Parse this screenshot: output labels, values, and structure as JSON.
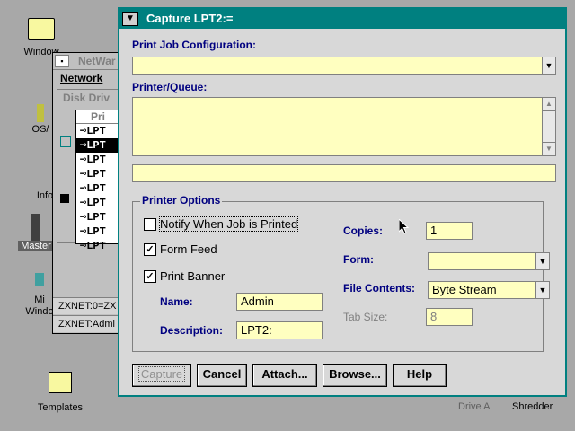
{
  "desktop": {
    "icons": [
      {
        "label": "Window"
      },
      {
        "label": "OS/"
      },
      {
        "label": "Info"
      },
      {
        "label": "Master"
      },
      {
        "label": "Mi Windo"
      },
      {
        "label": "Templates"
      }
    ],
    "bottom": {
      "drive": "Drive A",
      "shredder": "Shredder"
    }
  },
  "netware": {
    "title": "NetWar",
    "menu": "Network",
    "panel_title": "Disk Driv",
    "list_header": "Pri",
    "ports": [
      "LPT",
      "LPT",
      "LPT",
      "LPT",
      "LPT",
      "LPT",
      "LPT",
      "LPT",
      "LPT"
    ],
    "status": [
      "ZXNET:0=ZX",
      "ZXNET:Admi"
    ]
  },
  "dialog": {
    "title": "Capture LPT2:=",
    "sys_menu": "▼",
    "print_job_label": "Print Job Configuration:",
    "print_job_value": "",
    "printer_queue_label": "Printer/Queue:",
    "printer_queue_value": "",
    "queue_path_value": "",
    "options_title": "Printer Options",
    "notify_label": "Notify When Job is Printed",
    "notify_checked": false,
    "form_feed_label": "Form Feed",
    "form_feed_checked": true,
    "print_banner_label": "Print Banner",
    "print_banner_checked": true,
    "name_label": "Name:",
    "name_value": "Admin",
    "description_label": "Description:",
    "description_value": "LPT2:",
    "copies_label": "Copies:",
    "copies_value": "1",
    "form_label": "Form:",
    "form_value": "",
    "file_contents_label": "File Contents:",
    "file_contents_value": "Byte Stream",
    "tab_size_label": "Tab Size:",
    "tab_size_value": "8",
    "buttons": {
      "capture": "Capture",
      "cancel": "Cancel",
      "attach": "Attach...",
      "browse": "Browse...",
      "help": "Help"
    }
  },
  "colors": {
    "title_bar": "#008080",
    "field_bg": "#ffffc0",
    "label": "#000080",
    "desktop": "#a8a8a8"
  },
  "icons": {
    "checkmark": "check-icon",
    "dropdown": "chevron-down-icon",
    "system_menu": "system-menu-icon"
  }
}
